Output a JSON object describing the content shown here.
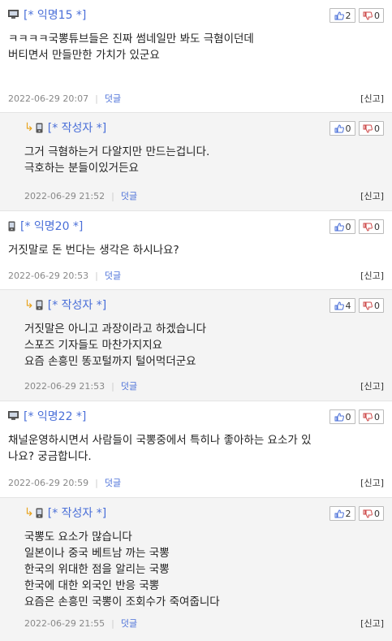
{
  "comments": [
    {
      "type": "top",
      "device": "pc",
      "author": "[* 익명15 *]",
      "up": "2",
      "down": "0",
      "text": "ㅋㅋㅋㅋ국뽕튜브들은 진짜 썸네일만 봐도 극혐이던데\n버티면서 만들만한 가치가 있군요",
      "date": "2022-06-29 20:07",
      "reply": "덧글",
      "report": "[신고]"
    },
    {
      "type": "reply",
      "device": "phone",
      "author": "[* 작성자 *]",
      "up": "0",
      "down": "0",
      "text": "그거 극혐하는거 다알지만 만드는겁니다.\n극호하는 분들이있거든요",
      "date": "2022-06-29 21:52",
      "reply": "덧글",
      "report": "[신고]"
    },
    {
      "type": "top",
      "device": "phone",
      "author": "[* 익명20 *]",
      "up": "0",
      "down": "0",
      "text": "거짓말로 돈 번다는 생각은 하시나요?",
      "date": "2022-06-29 20:53",
      "reply": "덧글",
      "report": "[신고]"
    },
    {
      "type": "reply",
      "device": "phone",
      "author": "[* 작성자 *]",
      "up": "4",
      "down": "0",
      "text": "거짓말은 아니고 과장이라고 하겠습니다\n스포즈 기자들도 마찬가지지요\n요즘 손흥민 똥꼬털까지 털어먹더군요",
      "date": "2022-06-29 21:53",
      "reply": "덧글",
      "report": "[신고]"
    },
    {
      "type": "top",
      "device": "pc",
      "author": "[* 익명22 *]",
      "up": "0",
      "down": "0",
      "text": "채널운영하시면서 사람들이 국뽕중에서 특히나 좋아하는 요소가 있\n나요? 궁금합니다.",
      "date": "2022-06-29 20:59",
      "reply": "덧글",
      "report": "[신고]"
    },
    {
      "type": "reply",
      "device": "phone",
      "author": "[* 작성자 *]",
      "up": "2",
      "down": "0",
      "text": "국뽕도 요소가 많습니다\n일본이나 중국 베트남 까는 국뽕\n한국의 위대한 점을 알리는 국뽕\n한국에 대한 외국인 반응 국뽕\n요즘은 손흥민 국뽕이 조회수가 죽여줍니다",
      "date": "2022-06-29 21:55",
      "reply": "덧글",
      "report": "[신고]"
    }
  ]
}
